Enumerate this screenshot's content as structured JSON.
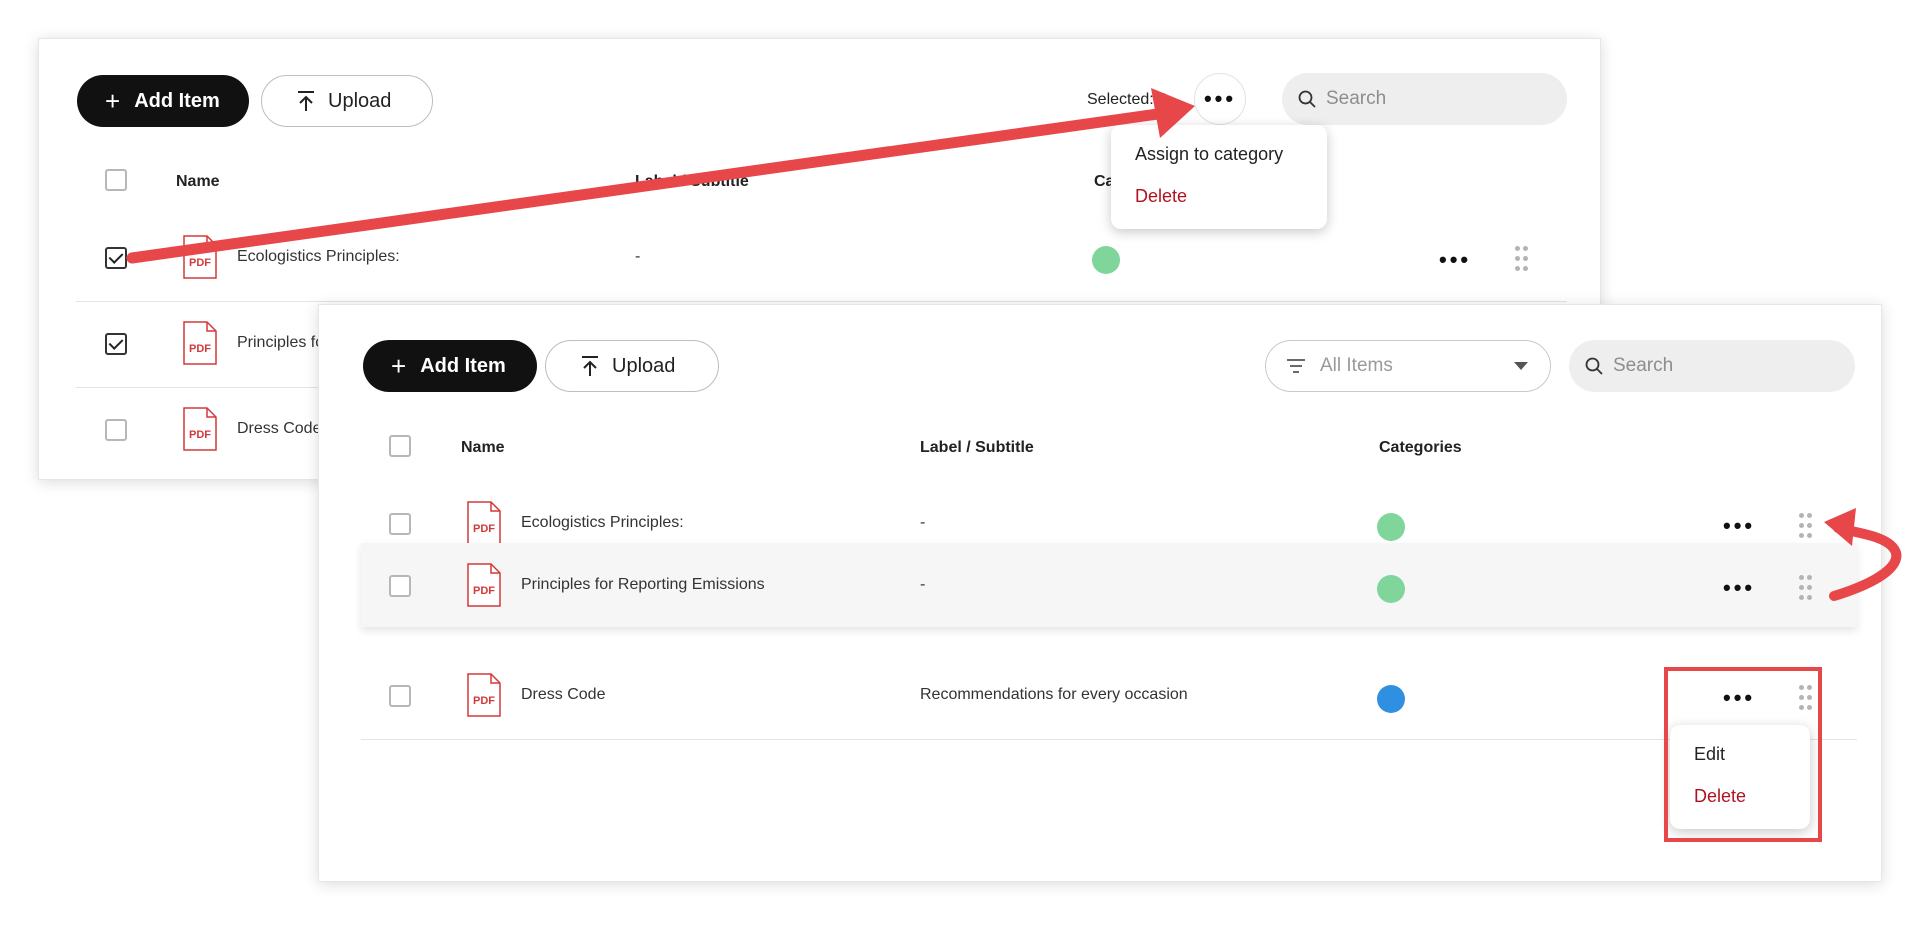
{
  "toolbar": {
    "add_label": "Add Item",
    "upload_label": "Upload",
    "search_placeholder": "Search",
    "selected_text": "Selected: 2",
    "filter_label": "All Items"
  },
  "table": {
    "columns": [
      "Name",
      "Label / Subtitle",
      "Categories"
    ],
    "back_columns": [
      "Name",
      "Label / Subtitle",
      "Ca"
    ]
  },
  "rows": [
    {
      "name": "Ecologistics Principles:",
      "subtitle": "-",
      "category_color": "#7fd59a"
    },
    {
      "name": "Principles for Reporting Emissions",
      "subtitle": "-",
      "category_color": "#7fd59a"
    },
    {
      "name": "Dress Code",
      "subtitle": "Recommendations for every occasion",
      "category_color": "#2f8fe0"
    }
  ],
  "back_rows": [
    {
      "name": "Ecologistics Principles:",
      "subtitle": "-",
      "checked": true
    },
    {
      "name": "Principles fo",
      "checked": true
    },
    {
      "name": "Dress Code",
      "checked": false
    }
  ],
  "bulk_menu": {
    "items": [
      "Assign to category",
      "Delete"
    ]
  },
  "row_menu": {
    "items": [
      "Edit",
      "Delete"
    ]
  },
  "icon_text": {
    "pdf": "PDF"
  },
  "colors": {
    "accent": "#111111",
    "danger": "#b0121f",
    "annotation": "#e8474a"
  }
}
